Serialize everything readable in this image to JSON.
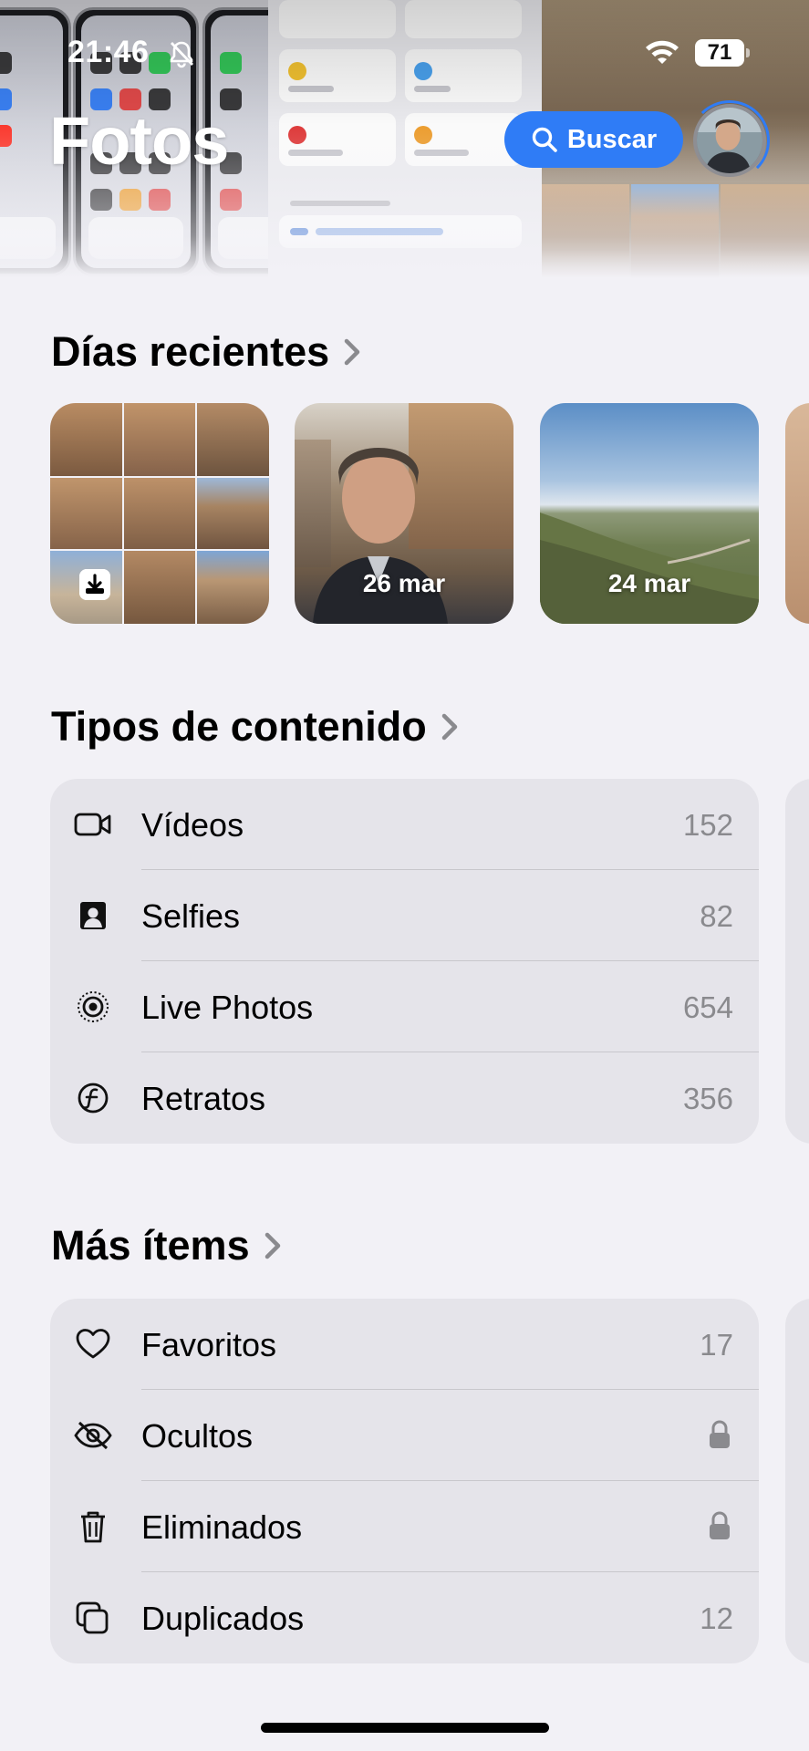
{
  "status_bar": {
    "time": "21:46",
    "battery": "71",
    "icons": [
      "bell-slash-icon",
      "wifi-icon",
      "battery-icon"
    ]
  },
  "header": {
    "title": "Fotos",
    "search_label": "Buscar",
    "accent_color": "#2f7cf6"
  },
  "sections": {
    "recent_days": {
      "title": "Días recientes",
      "cards": [
        {
          "label": "",
          "kind": "collage"
        },
        {
          "label": "26 mar",
          "kind": "selfie"
        },
        {
          "label": "24 mar",
          "kind": "landscape"
        }
      ]
    },
    "content_types": {
      "title": "Tipos de contenido",
      "items": [
        {
          "label": "Vídeos",
          "count": "152",
          "icon": "video-camera-icon"
        },
        {
          "label": "Selfies",
          "count": "82",
          "icon": "selfie-portrait-icon"
        },
        {
          "label": "Live Photos",
          "count": "654",
          "icon": "live-photos-icon"
        },
        {
          "label": "Retratos",
          "count": "356",
          "icon": "portrait-f-icon"
        }
      ]
    },
    "more_items": {
      "title": "Más ítems",
      "items": [
        {
          "label": "Favoritos",
          "count": "17",
          "icon": "heart-icon"
        },
        {
          "label": "Ocultos",
          "count": "",
          "icon": "eye-slash-icon",
          "locked": true
        },
        {
          "label": "Eliminados",
          "count": "",
          "icon": "trash-icon",
          "locked": true
        },
        {
          "label": "Duplicados",
          "count": "12",
          "icon": "duplicates-icon"
        }
      ]
    }
  }
}
